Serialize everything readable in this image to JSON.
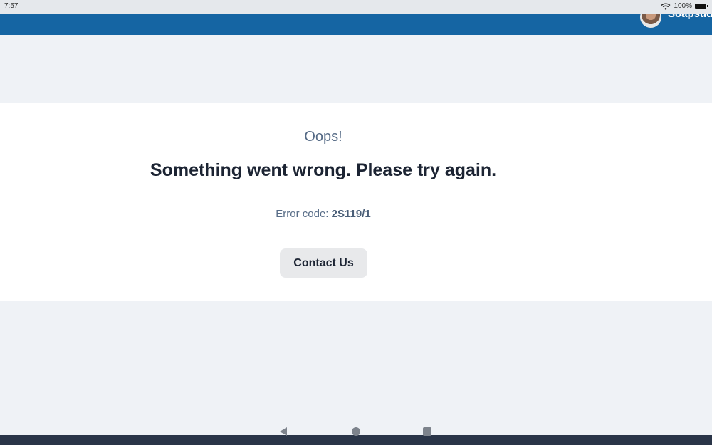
{
  "status_bar": {
    "time": "7:57",
    "battery": "100%",
    "icons": [
      "wifi-icon",
      "battery-icon"
    ]
  },
  "header": {
    "user_name": "Soapsuds",
    "avatar_icon": "avatar",
    "color": "#1565a3"
  },
  "error": {
    "oops": "Oops!",
    "message": "Something went wrong. Please try again.",
    "code_label": "Error code:",
    "code_value": "2S119/1",
    "contact_label": "Contact Us"
  },
  "navigation": {
    "icons": [
      "back-icon",
      "home-icon",
      "recents-icon"
    ]
  }
}
